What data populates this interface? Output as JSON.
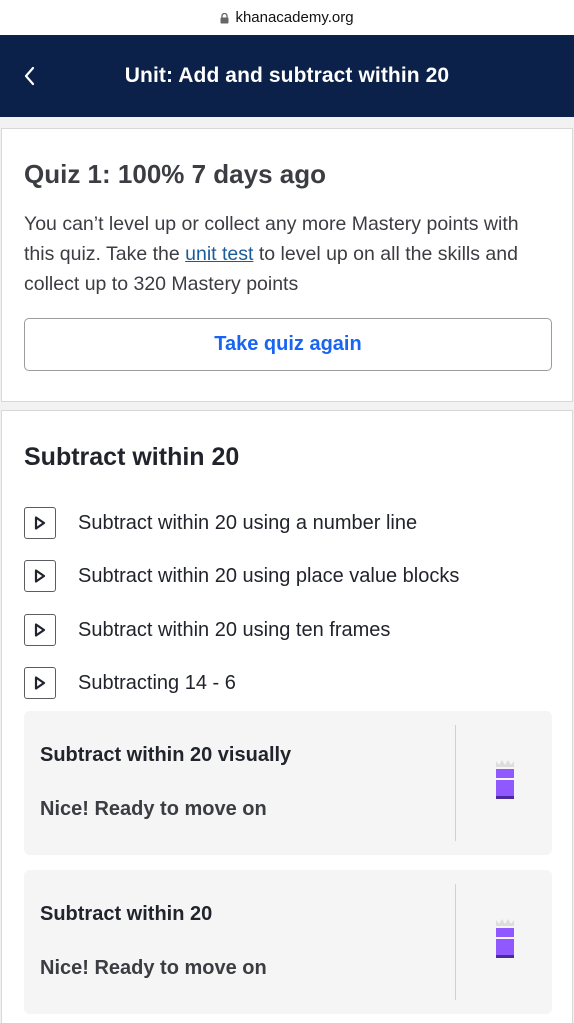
{
  "browser": {
    "url": "khanacademy.org"
  },
  "header": {
    "title": "Unit: Add and subtract within 20"
  },
  "quiz": {
    "title": "Quiz 1: 100% 7 days ago",
    "text_before": "You can’t level up or collect any more Mastery points with this quiz. Take the ",
    "link": "unit test",
    "text_after": " to level up on all the skills and collect up to 320 Mastery points",
    "button": "Take quiz again"
  },
  "section": {
    "title": "Subtract within 20",
    "videos": [
      {
        "label": "Subtract within 20 using a number line"
      },
      {
        "label": "Subtract within 20 using place value blocks"
      },
      {
        "label": "Subtract within 20 using ten frames"
      },
      {
        "label": "Subtracting 14 - 6"
      }
    ],
    "skills": [
      {
        "name": "Subtract within 20 visually",
        "status": "Nice! Ready to move on"
      },
      {
        "name": "Subtract within 20",
        "status": "Nice! Ready to move on"
      }
    ]
  },
  "colors": {
    "header_bg": "#0b2149",
    "link": "#1865f2",
    "mastery_badge": "#9059ff"
  },
  "icons": {
    "lock": "lock-icon",
    "back": "chevron-left-icon",
    "video": "play-icon",
    "badge": "mastery-level-icon"
  }
}
